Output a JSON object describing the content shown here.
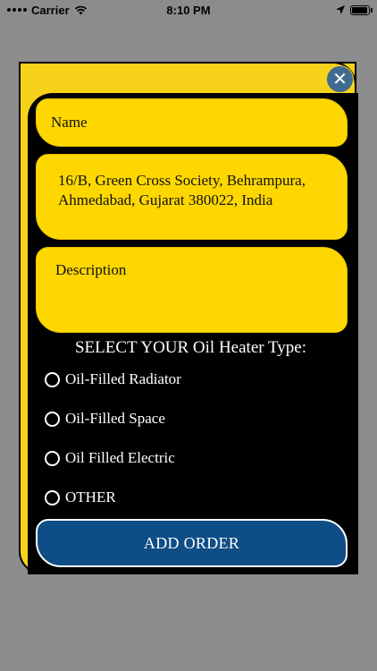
{
  "status_bar": {
    "carrier": "Carrier",
    "time": "8:10 PM"
  },
  "form": {
    "name_placeholder": "Name",
    "address_value": "16/B, Green Cross Society, Behrampura, Ahmedabad, Gujarat 380022, India",
    "description_placeholder": "Description",
    "section_title": "SELECT YOUR Oil Heater Type:",
    "options": [
      {
        "label": "Oil-Filled Radiator"
      },
      {
        "label": "Oil-Filled Space"
      },
      {
        "label": "Oil Filled Electric"
      },
      {
        "label": "OTHER"
      }
    ],
    "submit_label": "ADD ORDER",
    "close_glyph": "✕"
  },
  "colors": {
    "background": "#8c8c8c",
    "card_yellow": "#f7d21a",
    "field_yellow": "#fed700",
    "button_blue": "#0f4d86",
    "close_blue": "#3e6b8f"
  }
}
